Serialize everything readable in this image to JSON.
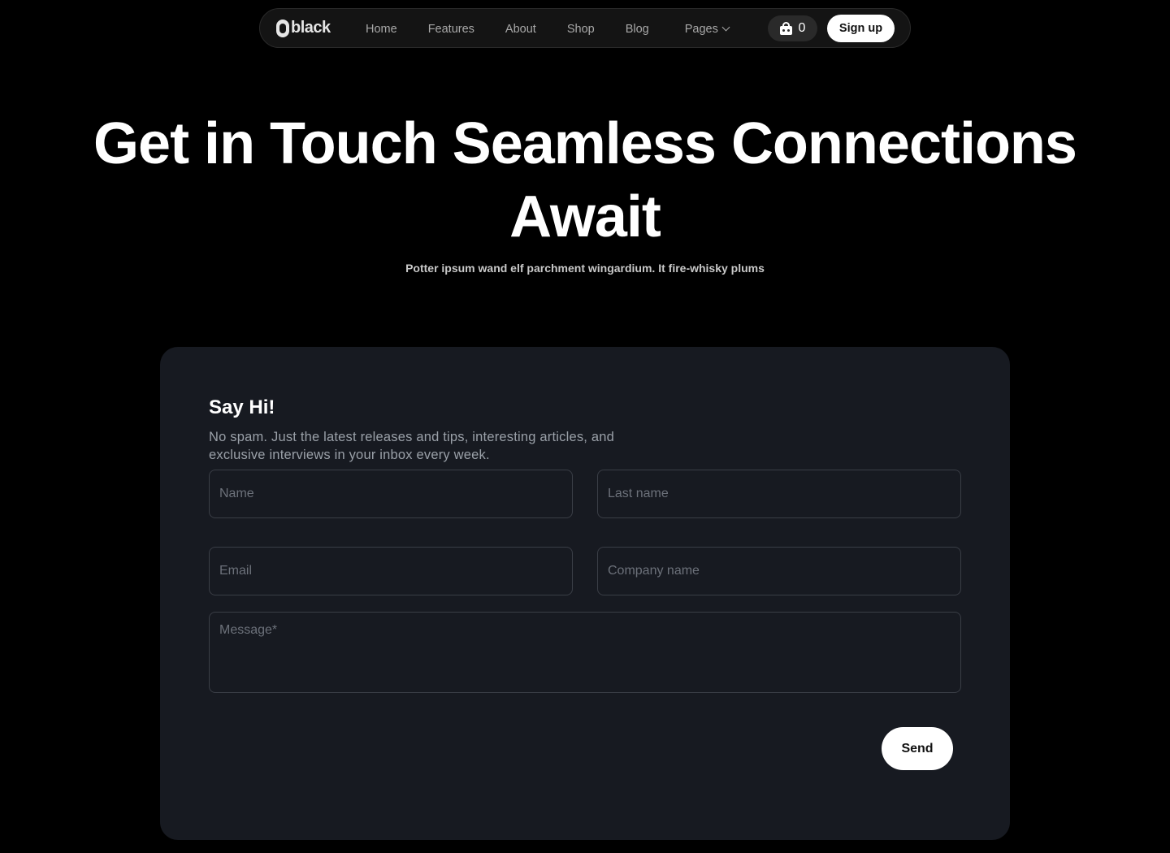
{
  "nav": {
    "logo_text": "black",
    "links": [
      "Home",
      "Features",
      "About",
      "Shop",
      "Blog",
      "Pages"
    ],
    "cart_count": "0",
    "signup_label": "Sign up"
  },
  "hero": {
    "title_line1": "Get in Touch Seamless Connections",
    "title_line2": "Await",
    "subtitle": "Potter ipsum wand elf parchment wingardium. It fire-whisky plums"
  },
  "form": {
    "title": "Say Hi!",
    "description": "No spam. Just the latest releases and tips, interesting articles, and exclusive interviews in your inbox every week.",
    "name_placeholder": "Name",
    "last_name_placeholder": "Last name",
    "email_placeholder": "Email",
    "company_placeholder": "Company name",
    "message_placeholder": "Message*",
    "send_label": "Send"
  },
  "icons": {
    "logo": "logo-icon",
    "cart": "shopping-bag-icon",
    "pages_dropdown": "chevron-down-icon"
  }
}
